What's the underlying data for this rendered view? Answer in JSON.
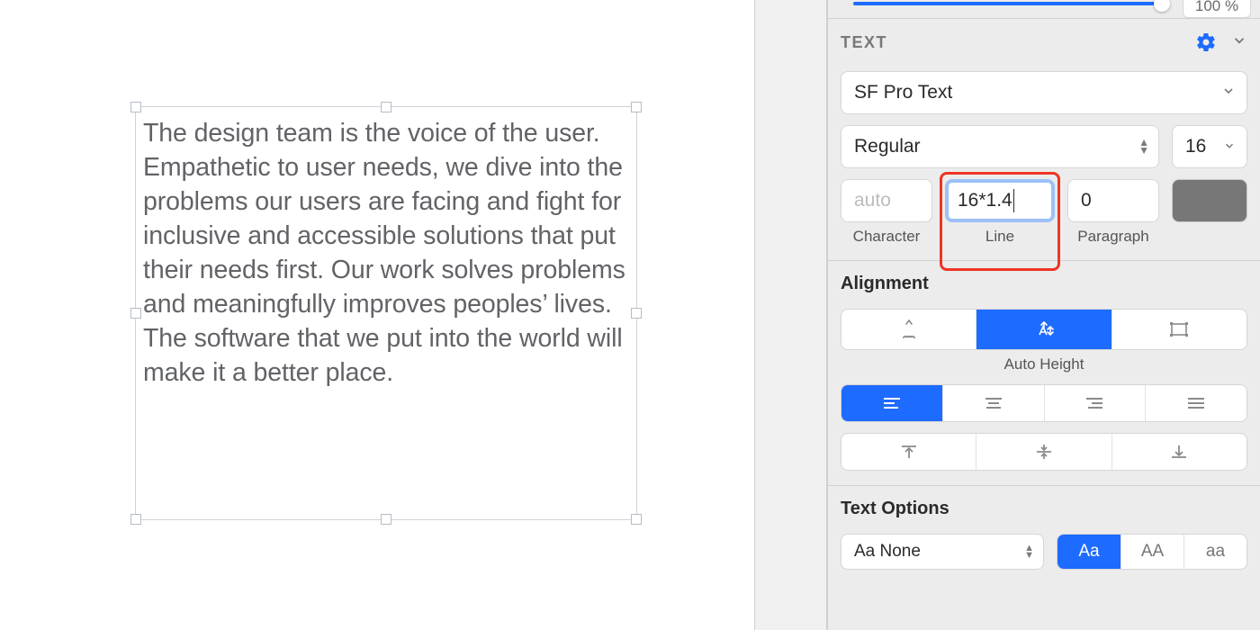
{
  "canvas": {
    "text_block": "The design team is the voice of the user. Empathetic to user needs, we dive into the problems our users are facing and fight for inclusive and accessible solutions that put their needs first. Our work solves problems and meaningfully improves peoples’ lives. The software that we put into the world will make it a better place."
  },
  "top_slider": {
    "readout": "100 %"
  },
  "text_panel": {
    "title": "TEXT",
    "font_family": "SF Pro Text",
    "font_weight": "Regular",
    "font_size": "16",
    "spacing": {
      "character": {
        "value": "",
        "placeholder": "auto",
        "label": "Character"
      },
      "line": {
        "value": "16*1.4",
        "label": "Line"
      },
      "paragraph": {
        "value": "0",
        "label": "Paragraph"
      }
    }
  },
  "alignment": {
    "title": "Alignment",
    "sizing_caption": "Auto Height"
  },
  "text_options": {
    "title": "Text Options",
    "transform": "Aa None",
    "cases": [
      "Aa",
      "AA",
      "aa"
    ]
  }
}
